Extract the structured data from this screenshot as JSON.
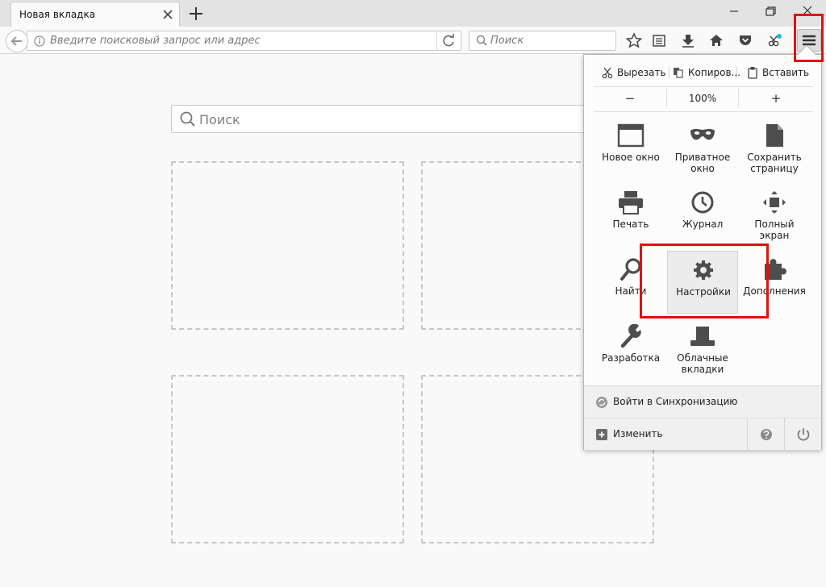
{
  "tab": {
    "title": "Новая вкладка"
  },
  "urlbar": {
    "placeholder": "Введите поисковый запрос или адрес"
  },
  "searchbar": {
    "placeholder": "Поиск"
  },
  "newtab": {
    "search_placeholder": "Поиск"
  },
  "panel": {
    "edit": {
      "cut": "Вырезать",
      "copy": "Копиров...",
      "paste": "Вставить"
    },
    "zoom": {
      "out": "−",
      "value": "100%",
      "in": "+"
    },
    "items": [
      {
        "label": "Новое окно",
        "icon": "window-icon"
      },
      {
        "label": "Приватное окно",
        "icon": "mask-icon"
      },
      {
        "label": "Сохранить страницу",
        "icon": "page-icon"
      },
      {
        "label": "Печать",
        "icon": "printer-icon"
      },
      {
        "label": "Журнал",
        "icon": "clock-icon"
      },
      {
        "label": "Полный экран",
        "icon": "fullscreen-icon"
      },
      {
        "label": "Найти",
        "icon": "magnifier-icon"
      },
      {
        "label": "Настройки",
        "icon": "gear-icon"
      },
      {
        "label": "Дополнения",
        "icon": "puzzle-icon"
      },
      {
        "label": "Разработка",
        "icon": "wrench-icon"
      },
      {
        "label": "Облачные вкладки",
        "icon": "cloud-tabs-icon"
      }
    ],
    "sync_label": "Войти в Синхронизацию",
    "customize_label": "Изменить"
  },
  "colors": {
    "highlight": "#e01010",
    "panel_bg": "#fcfcfc",
    "icon": "#4d4d4d"
  }
}
